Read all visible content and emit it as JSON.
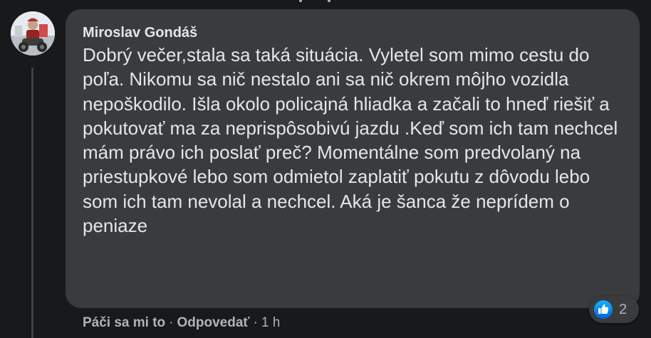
{
  "comment": {
    "author": "Miroslav Gondáš",
    "text": "Dobrý večer,stala sa taká situácia. Vyletel som mimo cestu do poľa. Nikomu sa nič nestalo ani sa nič okrem môjho vozidla nepoškodilo. Išla okolo policajná hliadka a začali to hneď riešiť a pokutovať ma za neprispôsobivú jazdu .Keď som ich tam nechcel mám právo ich poslať preč? Momentálne som predvolaný na priestupkové lebo som odmietol zaplatiť pokutu z dôvodu lebo som ich tam nevolal a nechcel. Aká je šanca že neprídem o peniaze",
    "avatar_icon": "profile-photo",
    "reaction_icon": "like-icon",
    "reaction_count": "2"
  },
  "actions": {
    "like_label": "Páči sa mi to",
    "reply_label": "Odpovedať",
    "separator": "·",
    "time": "1 h"
  },
  "colors": {
    "background": "#18191a",
    "bubble": "#3a3b3c",
    "text": "#e4e6eb",
    "secondary_text": "#b0b3b8",
    "like_blue": "#0866ff"
  }
}
